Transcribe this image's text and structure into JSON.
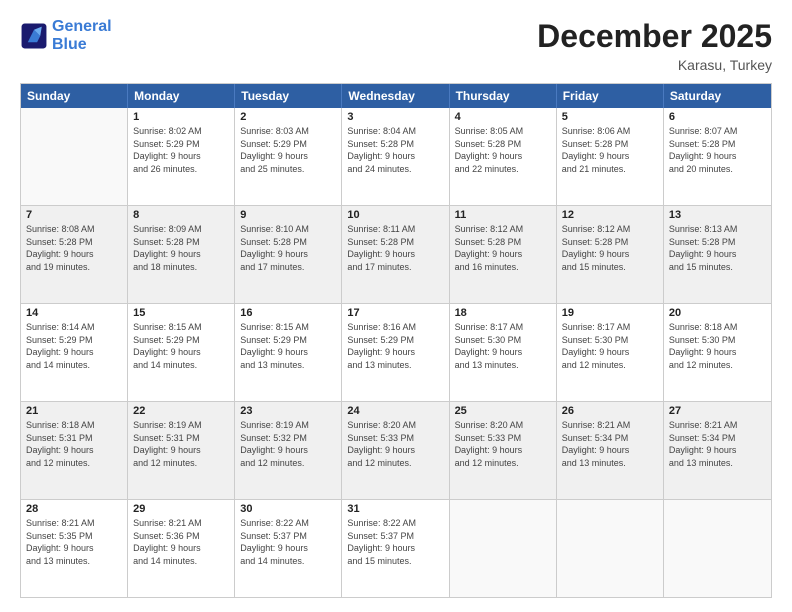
{
  "logo": {
    "line1": "General",
    "line2": "Blue"
  },
  "title": "December 2025",
  "subtitle": "Karasu, Turkey",
  "header_days": [
    "Sunday",
    "Monday",
    "Tuesday",
    "Wednesday",
    "Thursday",
    "Friday",
    "Saturday"
  ],
  "weeks": [
    [
      {
        "day": "",
        "sunrise": "",
        "sunset": "",
        "daylight": "",
        "shaded": false,
        "empty": true
      },
      {
        "day": "1",
        "sunrise": "Sunrise: 8:02 AM",
        "sunset": "Sunset: 5:29 PM",
        "daylight": "Daylight: 9 hours",
        "daylight2": "and 26 minutes.",
        "shaded": false
      },
      {
        "day": "2",
        "sunrise": "Sunrise: 8:03 AM",
        "sunset": "Sunset: 5:29 PM",
        "daylight": "Daylight: 9 hours",
        "daylight2": "and 25 minutes.",
        "shaded": false
      },
      {
        "day": "3",
        "sunrise": "Sunrise: 8:04 AM",
        "sunset": "Sunset: 5:28 PM",
        "daylight": "Daylight: 9 hours",
        "daylight2": "and 24 minutes.",
        "shaded": false
      },
      {
        "day": "4",
        "sunrise": "Sunrise: 8:05 AM",
        "sunset": "Sunset: 5:28 PM",
        "daylight": "Daylight: 9 hours",
        "daylight2": "and 22 minutes.",
        "shaded": false
      },
      {
        "day": "5",
        "sunrise": "Sunrise: 8:06 AM",
        "sunset": "Sunset: 5:28 PM",
        "daylight": "Daylight: 9 hours",
        "daylight2": "and 21 minutes.",
        "shaded": false
      },
      {
        "day": "6",
        "sunrise": "Sunrise: 8:07 AM",
        "sunset": "Sunset: 5:28 PM",
        "daylight": "Daylight: 9 hours",
        "daylight2": "and 20 minutes.",
        "shaded": false
      }
    ],
    [
      {
        "day": "7",
        "sunrise": "Sunrise: 8:08 AM",
        "sunset": "Sunset: 5:28 PM",
        "daylight": "Daylight: 9 hours",
        "daylight2": "and 19 minutes.",
        "shaded": true
      },
      {
        "day": "8",
        "sunrise": "Sunrise: 8:09 AM",
        "sunset": "Sunset: 5:28 PM",
        "daylight": "Daylight: 9 hours",
        "daylight2": "and 18 minutes.",
        "shaded": true
      },
      {
        "day": "9",
        "sunrise": "Sunrise: 8:10 AM",
        "sunset": "Sunset: 5:28 PM",
        "daylight": "Daylight: 9 hours",
        "daylight2": "and 17 minutes.",
        "shaded": true
      },
      {
        "day": "10",
        "sunrise": "Sunrise: 8:11 AM",
        "sunset": "Sunset: 5:28 PM",
        "daylight": "Daylight: 9 hours",
        "daylight2": "and 17 minutes.",
        "shaded": true
      },
      {
        "day": "11",
        "sunrise": "Sunrise: 8:12 AM",
        "sunset": "Sunset: 5:28 PM",
        "daylight": "Daylight: 9 hours",
        "daylight2": "and 16 minutes.",
        "shaded": true
      },
      {
        "day": "12",
        "sunrise": "Sunrise: 8:12 AM",
        "sunset": "Sunset: 5:28 PM",
        "daylight": "Daylight: 9 hours",
        "daylight2": "and 15 minutes.",
        "shaded": true
      },
      {
        "day": "13",
        "sunrise": "Sunrise: 8:13 AM",
        "sunset": "Sunset: 5:28 PM",
        "daylight": "Daylight: 9 hours",
        "daylight2": "and 15 minutes.",
        "shaded": true
      }
    ],
    [
      {
        "day": "14",
        "sunrise": "Sunrise: 8:14 AM",
        "sunset": "Sunset: 5:29 PM",
        "daylight": "Daylight: 9 hours",
        "daylight2": "and 14 minutes.",
        "shaded": false
      },
      {
        "day": "15",
        "sunrise": "Sunrise: 8:15 AM",
        "sunset": "Sunset: 5:29 PM",
        "daylight": "Daylight: 9 hours",
        "daylight2": "and 14 minutes.",
        "shaded": false
      },
      {
        "day": "16",
        "sunrise": "Sunrise: 8:15 AM",
        "sunset": "Sunset: 5:29 PM",
        "daylight": "Daylight: 9 hours",
        "daylight2": "and 13 minutes.",
        "shaded": false
      },
      {
        "day": "17",
        "sunrise": "Sunrise: 8:16 AM",
        "sunset": "Sunset: 5:29 PM",
        "daylight": "Daylight: 9 hours",
        "daylight2": "and 13 minutes.",
        "shaded": false
      },
      {
        "day": "18",
        "sunrise": "Sunrise: 8:17 AM",
        "sunset": "Sunset: 5:30 PM",
        "daylight": "Daylight: 9 hours",
        "daylight2": "and 13 minutes.",
        "shaded": false
      },
      {
        "day": "19",
        "sunrise": "Sunrise: 8:17 AM",
        "sunset": "Sunset: 5:30 PM",
        "daylight": "Daylight: 9 hours",
        "daylight2": "and 12 minutes.",
        "shaded": false
      },
      {
        "day": "20",
        "sunrise": "Sunrise: 8:18 AM",
        "sunset": "Sunset: 5:30 PM",
        "daylight": "Daylight: 9 hours",
        "daylight2": "and 12 minutes.",
        "shaded": false
      }
    ],
    [
      {
        "day": "21",
        "sunrise": "Sunrise: 8:18 AM",
        "sunset": "Sunset: 5:31 PM",
        "daylight": "Daylight: 9 hours",
        "daylight2": "and 12 minutes.",
        "shaded": true
      },
      {
        "day": "22",
        "sunrise": "Sunrise: 8:19 AM",
        "sunset": "Sunset: 5:31 PM",
        "daylight": "Daylight: 9 hours",
        "daylight2": "and 12 minutes.",
        "shaded": true
      },
      {
        "day": "23",
        "sunrise": "Sunrise: 8:19 AM",
        "sunset": "Sunset: 5:32 PM",
        "daylight": "Daylight: 9 hours",
        "daylight2": "and 12 minutes.",
        "shaded": true
      },
      {
        "day": "24",
        "sunrise": "Sunrise: 8:20 AM",
        "sunset": "Sunset: 5:33 PM",
        "daylight": "Daylight: 9 hours",
        "daylight2": "and 12 minutes.",
        "shaded": true
      },
      {
        "day": "25",
        "sunrise": "Sunrise: 8:20 AM",
        "sunset": "Sunset: 5:33 PM",
        "daylight": "Daylight: 9 hours",
        "daylight2": "and 12 minutes.",
        "shaded": true
      },
      {
        "day": "26",
        "sunrise": "Sunrise: 8:21 AM",
        "sunset": "Sunset: 5:34 PM",
        "daylight": "Daylight: 9 hours",
        "daylight2": "and 13 minutes.",
        "shaded": true
      },
      {
        "day": "27",
        "sunrise": "Sunrise: 8:21 AM",
        "sunset": "Sunset: 5:34 PM",
        "daylight": "Daylight: 9 hours",
        "daylight2": "and 13 minutes.",
        "shaded": true
      }
    ],
    [
      {
        "day": "28",
        "sunrise": "Sunrise: 8:21 AM",
        "sunset": "Sunset: 5:35 PM",
        "daylight": "Daylight: 9 hours",
        "daylight2": "and 13 minutes.",
        "shaded": false
      },
      {
        "day": "29",
        "sunrise": "Sunrise: 8:21 AM",
        "sunset": "Sunset: 5:36 PM",
        "daylight": "Daylight: 9 hours",
        "daylight2": "and 14 minutes.",
        "shaded": false
      },
      {
        "day": "30",
        "sunrise": "Sunrise: 8:22 AM",
        "sunset": "Sunset: 5:37 PM",
        "daylight": "Daylight: 9 hours",
        "daylight2": "and 14 minutes.",
        "shaded": false
      },
      {
        "day": "31",
        "sunrise": "Sunrise: 8:22 AM",
        "sunset": "Sunset: 5:37 PM",
        "daylight": "Daylight: 9 hours",
        "daylight2": "and 15 minutes.",
        "shaded": false
      },
      {
        "day": "",
        "sunrise": "",
        "sunset": "",
        "daylight": "",
        "daylight2": "",
        "shaded": false,
        "empty": true
      },
      {
        "day": "",
        "sunrise": "",
        "sunset": "",
        "daylight": "",
        "daylight2": "",
        "shaded": false,
        "empty": true
      },
      {
        "day": "",
        "sunrise": "",
        "sunset": "",
        "daylight": "",
        "daylight2": "",
        "shaded": false,
        "empty": true
      }
    ]
  ]
}
